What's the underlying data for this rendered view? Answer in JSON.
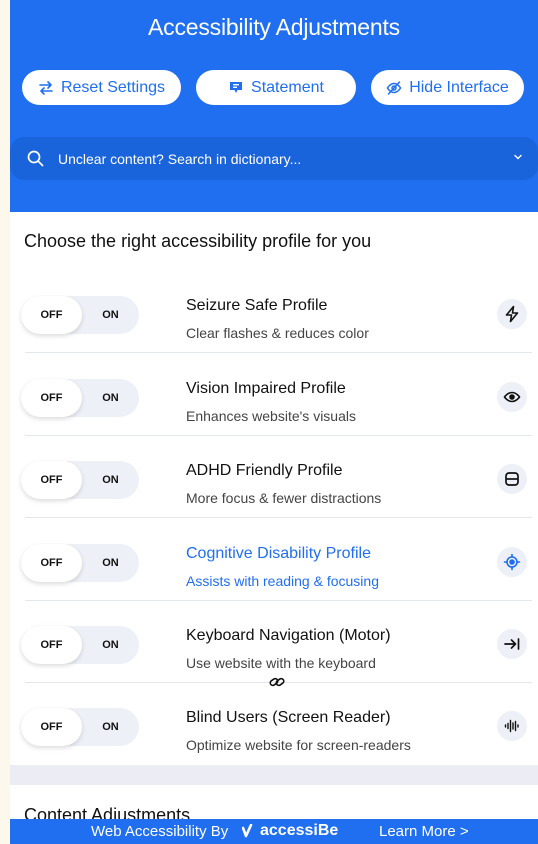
{
  "header": {
    "title": "Accessibility Adjustments",
    "buttons": {
      "reset": "Reset Settings",
      "statement": "Statement",
      "hide": "Hide Interface"
    },
    "search_placeholder": "Unclear content? Search in dictionary..."
  },
  "profiles": {
    "heading": "Choose the right accessibility profile for you",
    "items": [
      {
        "title": "Seizure Safe Profile",
        "desc": "Clear flashes & reduces color",
        "off": "OFF",
        "on": "ON",
        "icon": "lightning-icon",
        "active": false
      },
      {
        "title": "Vision Impaired Profile",
        "desc": "Enhances website's visuals",
        "off": "OFF",
        "on": "ON",
        "icon": "eye-icon",
        "active": false
      },
      {
        "title": "ADHD Friendly Profile",
        "desc": "More focus & fewer distractions",
        "off": "OFF",
        "on": "ON",
        "icon": "focus-frame-icon",
        "active": false
      },
      {
        "title": "Cognitive Disability Profile",
        "desc": "Assists with reading & focusing",
        "off": "OFF",
        "on": "ON",
        "icon": "target-icon",
        "active": true
      },
      {
        "title": "Keyboard Navigation (Motor)",
        "desc": "Use website with the keyboard",
        "off": "OFF",
        "on": "ON",
        "icon": "tab-arrow-icon",
        "active": false
      },
      {
        "title": "Blind Users (Screen Reader)",
        "desc": "Optimize website for screen-readers",
        "off": "OFF",
        "on": "ON",
        "icon": "audio-wave-icon",
        "active": false
      }
    ]
  },
  "content": {
    "heading": "Content Adjustments"
  },
  "footer": {
    "by": "Web Accessibility By",
    "brand": "accessiBe",
    "learn_more": "Learn More >"
  },
  "colors": {
    "accent": "#1f6ff0",
    "panel_bg": "#ecedf4",
    "toggle_track": "#eef0f7"
  }
}
